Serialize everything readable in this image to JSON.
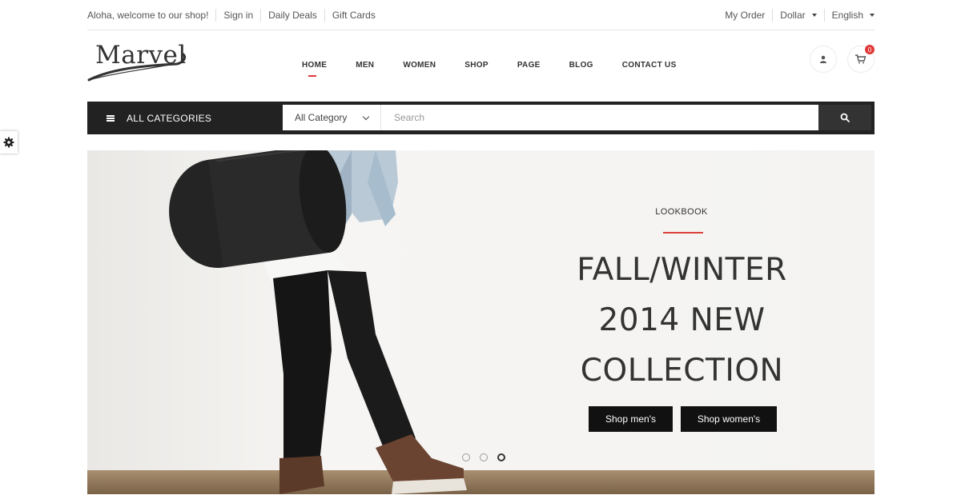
{
  "topbar": {
    "welcome": "Aloha, welcome to our shop!",
    "sign_in": "Sign in",
    "daily_deals": "Daily Deals",
    "gift_cards": "Gift Cards",
    "my_order": "My Order",
    "currency": "Dollar",
    "language": "English"
  },
  "logo": {
    "text": "Marvel"
  },
  "nav": {
    "items": [
      "HOME",
      "MEN",
      "WOMEN",
      "SHOP",
      "PAGE",
      "BLOG",
      "CONTACT US"
    ],
    "active": "HOME"
  },
  "header_icons": {
    "account_icon": "user-icon",
    "cart_icon": "shopping-cart-icon",
    "cart_count": "0"
  },
  "category_bar": {
    "all_categories": "ALL CATEGORIES",
    "category_select": "All Category",
    "search_placeholder": "Search",
    "search_icon": "search-icon"
  },
  "side_settings": {
    "icon": "gear-icon"
  },
  "hero": {
    "eyebrow": "LOOKBOOK",
    "headline_line1": "FALL/WINTER",
    "headline_line2": "2014 NEW",
    "headline_line3": "COLLECTION",
    "button_men": "Shop men's",
    "button_women": "Shop women's",
    "slides": 3,
    "active_slide": 3
  },
  "colors": {
    "accent": "#d9423a",
    "dark": "#222222",
    "button": "#111111"
  }
}
